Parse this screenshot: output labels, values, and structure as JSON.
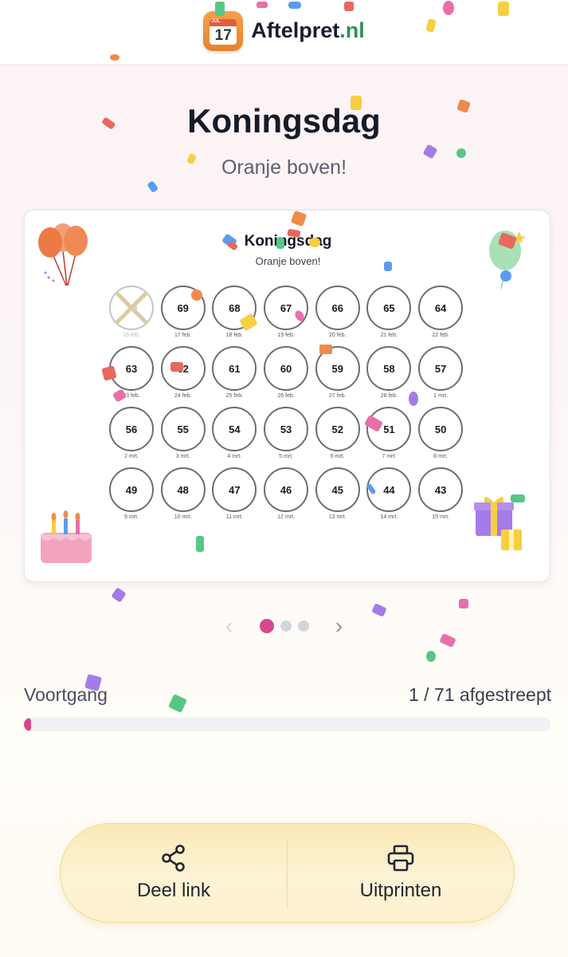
{
  "header": {
    "logo_month": "JUL",
    "logo_day": "17",
    "brand_name": "Aftelpret",
    "brand_tld": ".nl"
  },
  "page": {
    "title": "Koningsdag",
    "subtitle": "Oranje boven!"
  },
  "card": {
    "title": "Koningsdag",
    "subtitle": "Oranje boven!",
    "days": [
      {
        "num": "70",
        "date": "16 feb.",
        "done": true
      },
      {
        "num": "69",
        "date": "17 feb.",
        "done": false
      },
      {
        "num": "68",
        "date": "18 feb.",
        "done": false
      },
      {
        "num": "67",
        "date": "19 feb.",
        "done": false
      },
      {
        "num": "66",
        "date": "20 feb.",
        "done": false
      },
      {
        "num": "65",
        "date": "21 feb.",
        "done": false
      },
      {
        "num": "64",
        "date": "22 feb.",
        "done": false
      },
      {
        "num": "63",
        "date": "23 feb.",
        "done": false
      },
      {
        "num": "62",
        "date": "24 feb.",
        "done": false
      },
      {
        "num": "61",
        "date": "25 feb.",
        "done": false
      },
      {
        "num": "60",
        "date": "26 feb.",
        "done": false
      },
      {
        "num": "59",
        "date": "27 feb.",
        "done": false
      },
      {
        "num": "58",
        "date": "28 feb.",
        "done": false
      },
      {
        "num": "57",
        "date": "1 mrt.",
        "done": false
      },
      {
        "num": "56",
        "date": "2 mrt.",
        "done": false
      },
      {
        "num": "55",
        "date": "3 mrt.",
        "done": false
      },
      {
        "num": "54",
        "date": "4 mrt.",
        "done": false
      },
      {
        "num": "53",
        "date": "5 mrt.",
        "done": false
      },
      {
        "num": "52",
        "date": "6 mrt.",
        "done": false
      },
      {
        "num": "51",
        "date": "7 mrt.",
        "done": false
      },
      {
        "num": "50",
        "date": "8 mrt.",
        "done": false
      },
      {
        "num": "49",
        "date": "9 mrt.",
        "done": false
      },
      {
        "num": "48",
        "date": "10 mrt.",
        "done": false
      },
      {
        "num": "47",
        "date": "11 mrt.",
        "done": false
      },
      {
        "num": "46",
        "date": "12 mrt.",
        "done": false
      },
      {
        "num": "45",
        "date": "13 mrt.",
        "done": false
      },
      {
        "num": "44",
        "date": "14 mrt.",
        "done": false
      },
      {
        "num": "43",
        "date": "15 mrt.",
        "done": false
      }
    ]
  },
  "pager": {
    "prev_icon": "chevron-left-icon",
    "next_icon": "chevron-right-icon",
    "pages": 3,
    "active_page": 1
  },
  "progress": {
    "label": "Voortgang",
    "count_text": "1 / 71 afgestreept",
    "fraction": 0.014
  },
  "actions": {
    "share_label": "Deel link",
    "share_icon": "share-icon",
    "print_label": "Uitprinten",
    "print_icon": "printer-icon"
  },
  "colors": {
    "accent": "#d6478c",
    "brand_green": "#2f8f5b",
    "logo_orange": "#e8822a",
    "action_bar": "#fcf3d6"
  }
}
